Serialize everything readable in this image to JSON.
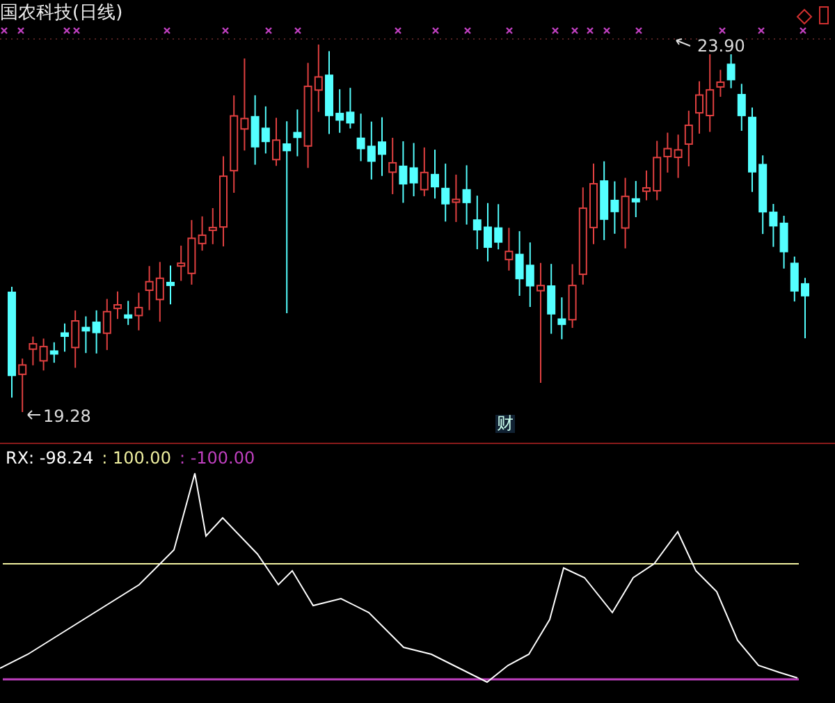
{
  "price_panel": {
    "title": "国农科技(日线)",
    "high_label": "23.90",
    "low_label": "19.28",
    "marker": "财"
  },
  "indicator_panel": {
    "series": [
      {
        "label": "RX: -98.24",
        "color": "#ffffff"
      },
      {
        "label": ": 100.00",
        "color": "#f0f0a0"
      },
      {
        "label": ": -100.00",
        "color": "#c040c0"
      }
    ]
  }
}
